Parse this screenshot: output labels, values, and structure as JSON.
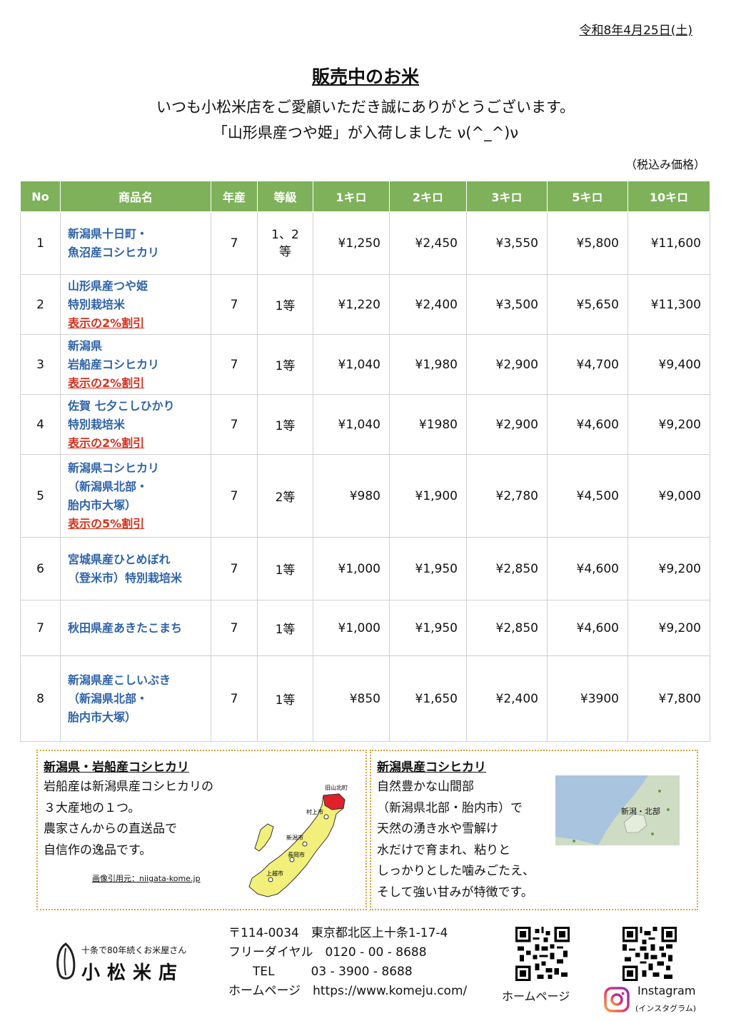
{
  "date": "令和8年4月25日(土)",
  "title": "販売中のお米",
  "greeting1": "いつも小松米店をご愛顧いただき誠にありがとうございます。",
  "greeting2": "「山形県産つや姫」が入荷しました ν(^_^)ν",
  "tax_note": "（税込み価格）",
  "table": {
    "headers": [
      "No",
      "商品名",
      "年産",
      "等級",
      "1キロ",
      "2キロ",
      "3キロ",
      "5キロ",
      "10キロ"
    ],
    "rows": [
      {
        "no": "1",
        "name": [
          "新潟県十日町・",
          "魚沼産コシヒカリ"
        ],
        "discount": "",
        "year": "7",
        "grade": "1、2等",
        "p1": "¥1,250",
        "p2": "¥2,450",
        "p3": "¥3,550",
        "p5": "¥5,800",
        "p10": "¥11,600"
      },
      {
        "no": "2",
        "name": [
          "山形県産つや姫",
          "特別栽培米"
        ],
        "discount": "表示の2%割引",
        "year": "7",
        "grade": "1等",
        "p1": "¥1,220",
        "p2": "¥2,400",
        "p3": "¥3,500",
        "p5": "¥5,650",
        "p10": "¥11,300"
      },
      {
        "no": "3",
        "name": [
          "新潟県",
          "岩船産コシヒカリ"
        ],
        "discount": "表示の2%割引",
        "year": "7",
        "grade": "1等",
        "p1": "¥1,040",
        "p2": "¥1,980",
        "p3": "¥2,900",
        "p5": "¥4,700",
        "p10": "¥9,400"
      },
      {
        "no": "4",
        "name": [
          "佐賀 七夕こしひかり",
          "特別栽培米"
        ],
        "discount": "表示の2%割引",
        "year": "7",
        "grade": "1等",
        "p1": "¥1,040",
        "p2": "¥1980",
        "p3": "¥2,900",
        "p5": "¥4,600",
        "p10": "¥9,200"
      },
      {
        "no": "5",
        "name": [
          "新潟県コシヒカリ",
          "（新潟県北部・",
          "胎内市大塚）"
        ],
        "discount": "表示の5%割引",
        "year": "7",
        "grade": "2等",
        "p1": "¥980",
        "p2": "¥1,900",
        "p3": "¥2,780",
        "p5": "¥4,500",
        "p10": "¥9,000"
      },
      {
        "no": "6",
        "name": [
          "宮城県産ひとめぼれ",
          "（登米市）特別栽培米"
        ],
        "discount": "",
        "year": "7",
        "grade": "1等",
        "p1": "¥1,000",
        "p2": "¥1,950",
        "p3": "¥2,850",
        "p5": "¥4,600",
        "p10": "¥9,200"
      },
      {
        "no": "7",
        "name": [
          "秋田県産あきたこまち"
        ],
        "discount": "",
        "year": "7",
        "grade": "1等",
        "p1": "¥1,000",
        "p2": "¥1,950",
        "p3": "¥2,850",
        "p5": "¥4,600",
        "p10": "¥9,200"
      },
      {
        "no": "8",
        "name": [
          "新潟県産こしいぶき",
          "（新潟県北部・",
          "胎内市大塚）"
        ],
        "discount": "",
        "year": "7",
        "grade": "1等",
        "p1": "¥850",
        "p2": "¥1,650",
        "p3": "¥2,400",
        "p5": "¥3900",
        "p10": "¥7,800"
      }
    ]
  },
  "box1": {
    "heading": "新潟県・岩船産コシヒカリ",
    "lines": [
      "岩船産は新潟県産コシヒカリの",
      "３大産地の１つ。",
      "農家さんからの直送品で",
      "自信作の逸品です。"
    ],
    "credit": "画像引用元：niigata-kome.jp",
    "map_labels": [
      "旧山北町",
      "村上市",
      "新潟市",
      "長岡市",
      "上越市"
    ]
  },
  "box2": {
    "heading": "新潟県産コシヒカリ",
    "lines": [
      "自然豊かな山間部",
      "（新潟県北部・胎内市）で",
      "天然の湧き水や雪解け",
      "水だけで育まれ、粘りと",
      "しっかりとした噛みごたえ、",
      "そして強い甘みが特徴です。"
    ],
    "map_label": "新潟・北部"
  },
  "footer": {
    "logo_tagline": "十条で80年続くお米屋さん",
    "logo_name": "小松米店",
    "postal": "〒114-0034　東京都北区上十条1-17-4",
    "freedial": "フリーダイヤル　0120 - 00 - 8688",
    "tel": "　　TEL　　　03 - 3900 - 8688",
    "homepage": "ホームページ　https://www.komeju.com/",
    "qr_homepage_label": "ホームページ",
    "instagram_label": "Instagram",
    "instagram_sub": "(インスタグラム)"
  },
  "colors": {
    "header_green": "#7eb159",
    "name_blue": "#2e62a8",
    "discount_red": "#d6321e",
    "box_border": "#e0a13c"
  },
  "icons": [
    "rice-grain-logo-icon",
    "qr-code-icon",
    "instagram-icon"
  ]
}
